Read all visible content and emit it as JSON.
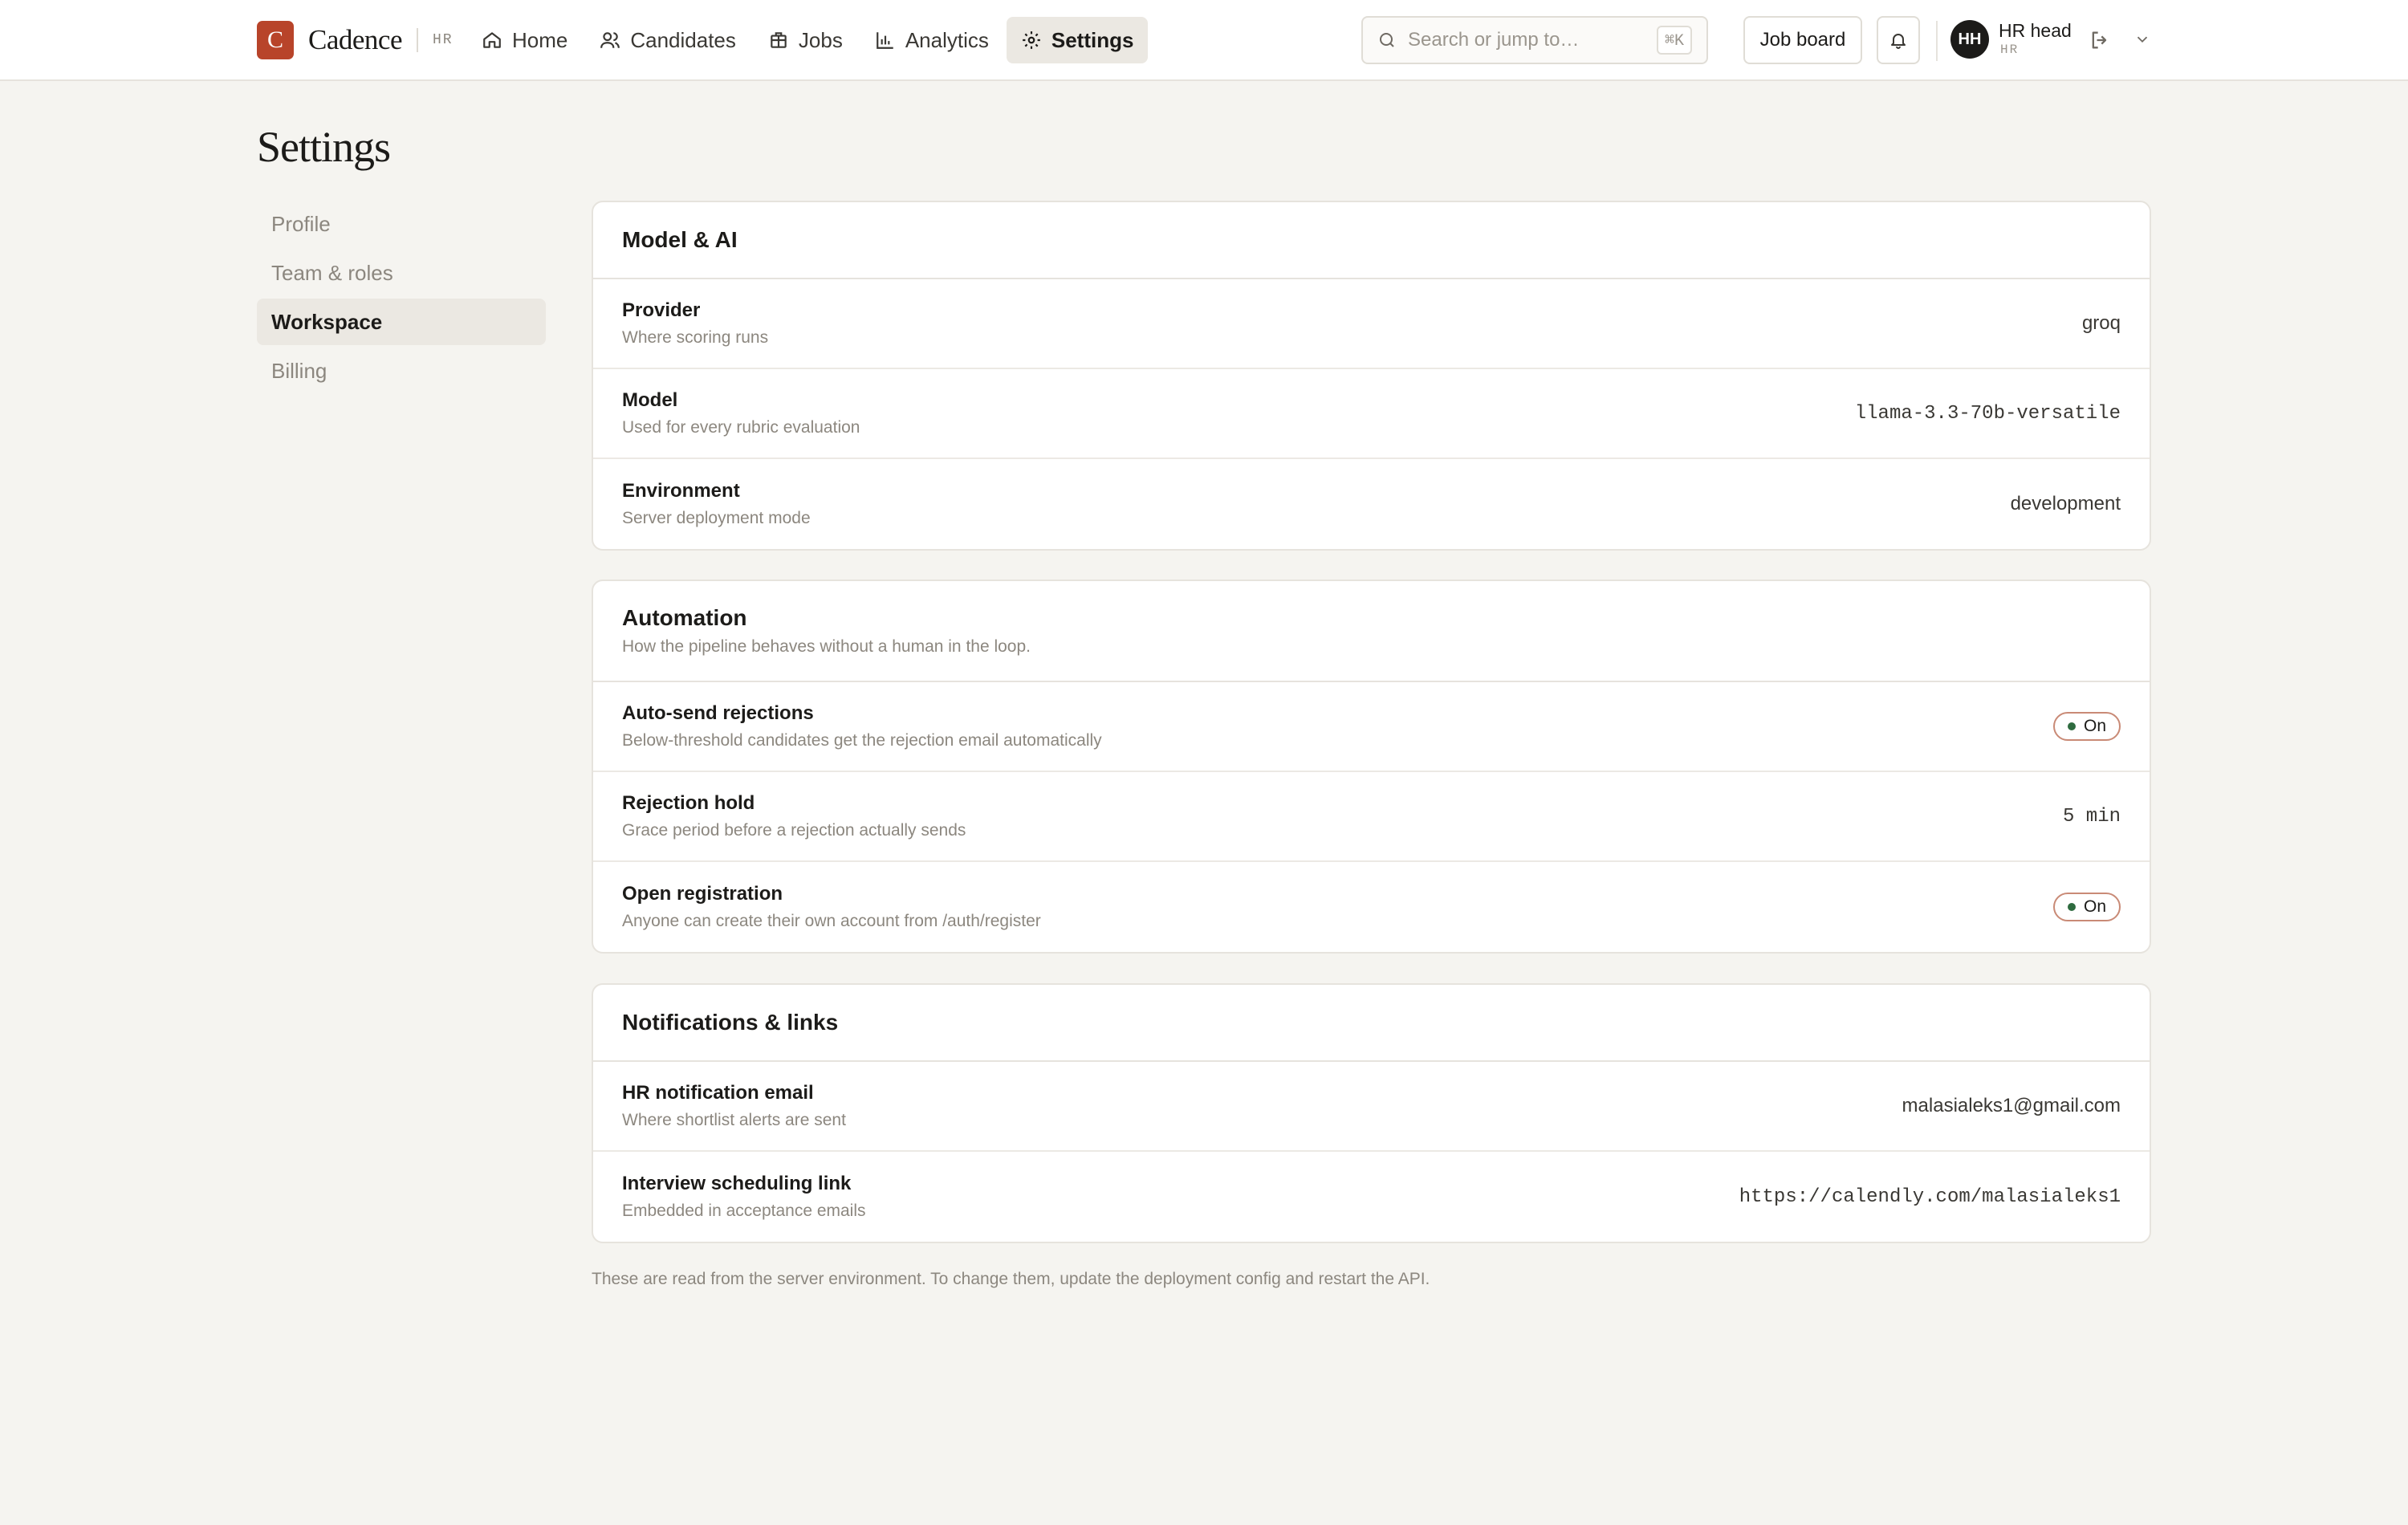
{
  "brand": {
    "logo_letter": "C",
    "name": "Cadence",
    "tag": "HR",
    "accent": "#b8442a"
  },
  "nav": [
    {
      "label": "Home",
      "icon": "home-icon"
    },
    {
      "label": "Candidates",
      "icon": "users-icon"
    },
    {
      "label": "Jobs",
      "icon": "briefcase-icon"
    },
    {
      "label": "Analytics",
      "icon": "bar-chart-icon"
    },
    {
      "label": "Settings",
      "icon": "gear-icon",
      "active": true
    }
  ],
  "search": {
    "placeholder": "Search or jump to…",
    "shortcut": "⌘K"
  },
  "header": {
    "job_board_label": "Job board"
  },
  "user": {
    "initials": "HH",
    "name": "HR head",
    "role": "HR"
  },
  "page": {
    "title": "Settings"
  },
  "sidebar": {
    "items": [
      {
        "label": "Profile"
      },
      {
        "label": "Team & roles"
      },
      {
        "label": "Workspace",
        "active": true
      },
      {
        "label": "Billing"
      }
    ]
  },
  "model_ai": {
    "title": "Model & AI",
    "rows": [
      {
        "label": "Provider",
        "desc": "Where scoring runs",
        "value": "groq"
      },
      {
        "label": "Model",
        "desc": "Used for every rubric evaluation",
        "value": "llama-3.3-70b-versatile"
      },
      {
        "label": "Environment",
        "desc": "Server deployment mode",
        "value": "development"
      }
    ]
  },
  "automation": {
    "title": "Automation",
    "subtitle": "How the pipeline behaves without a human in the loop.",
    "rows": [
      {
        "label": "Auto-send rejections",
        "desc": "Below-threshold candidates get the rejection email automatically",
        "value": "On"
      },
      {
        "label": "Rejection hold",
        "desc": "Grace period before a rejection actually sends",
        "value": "5 min"
      },
      {
        "label": "Open registration",
        "desc": "Anyone can create their own account from /auth/register",
        "value": "On"
      }
    ]
  },
  "notifications": {
    "title": "Notifications & links",
    "rows": [
      {
        "label": "HR notification email",
        "desc": "Where shortlist alerts are sent",
        "value": "malasialeks1@gmail.com"
      },
      {
        "label": "Interview scheduling link",
        "desc": "Embedded in acceptance emails",
        "value": "https://calendly.com/malasialeks1"
      }
    ]
  },
  "footnote": "These are read from the server environment. To change them, update the deployment config and restart the API."
}
